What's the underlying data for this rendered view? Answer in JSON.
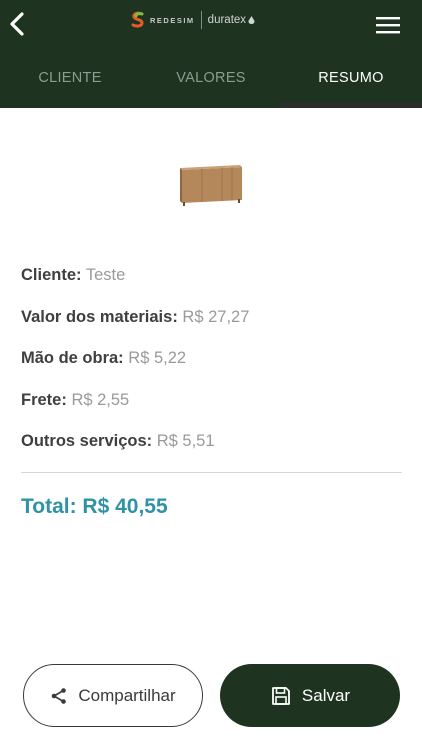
{
  "header": {
    "brand_left": "REDESIM",
    "brand_right": "duratex",
    "back_icon": "chevron-left-icon",
    "menu_icon": "hamburger-menu-icon"
  },
  "tabs": [
    {
      "label": "CLIENTE",
      "active": false
    },
    {
      "label": "VALORES",
      "active": false
    },
    {
      "label": "RESUMO",
      "active": true
    }
  ],
  "summary": {
    "cliente": {
      "label": "Cliente:",
      "value": "Teste"
    },
    "materiais": {
      "label": "Valor dos materiais:",
      "value": "R$ 27,27"
    },
    "mao_obra": {
      "label": "Mão de obra:",
      "value": "R$ 5,22"
    },
    "frete": {
      "label": "Frete:",
      "value": "R$ 2,55"
    },
    "outros": {
      "label": "Outros serviços:",
      "value": "R$ 5,51"
    },
    "total": "Total: R$ 40,55"
  },
  "actions": {
    "share_label": "Compartilhar",
    "save_label": "Salvar"
  },
  "colors": {
    "header_bg": "#1e3320",
    "accent_total": "#2f93a5",
    "save_button": "#1e3320"
  }
}
